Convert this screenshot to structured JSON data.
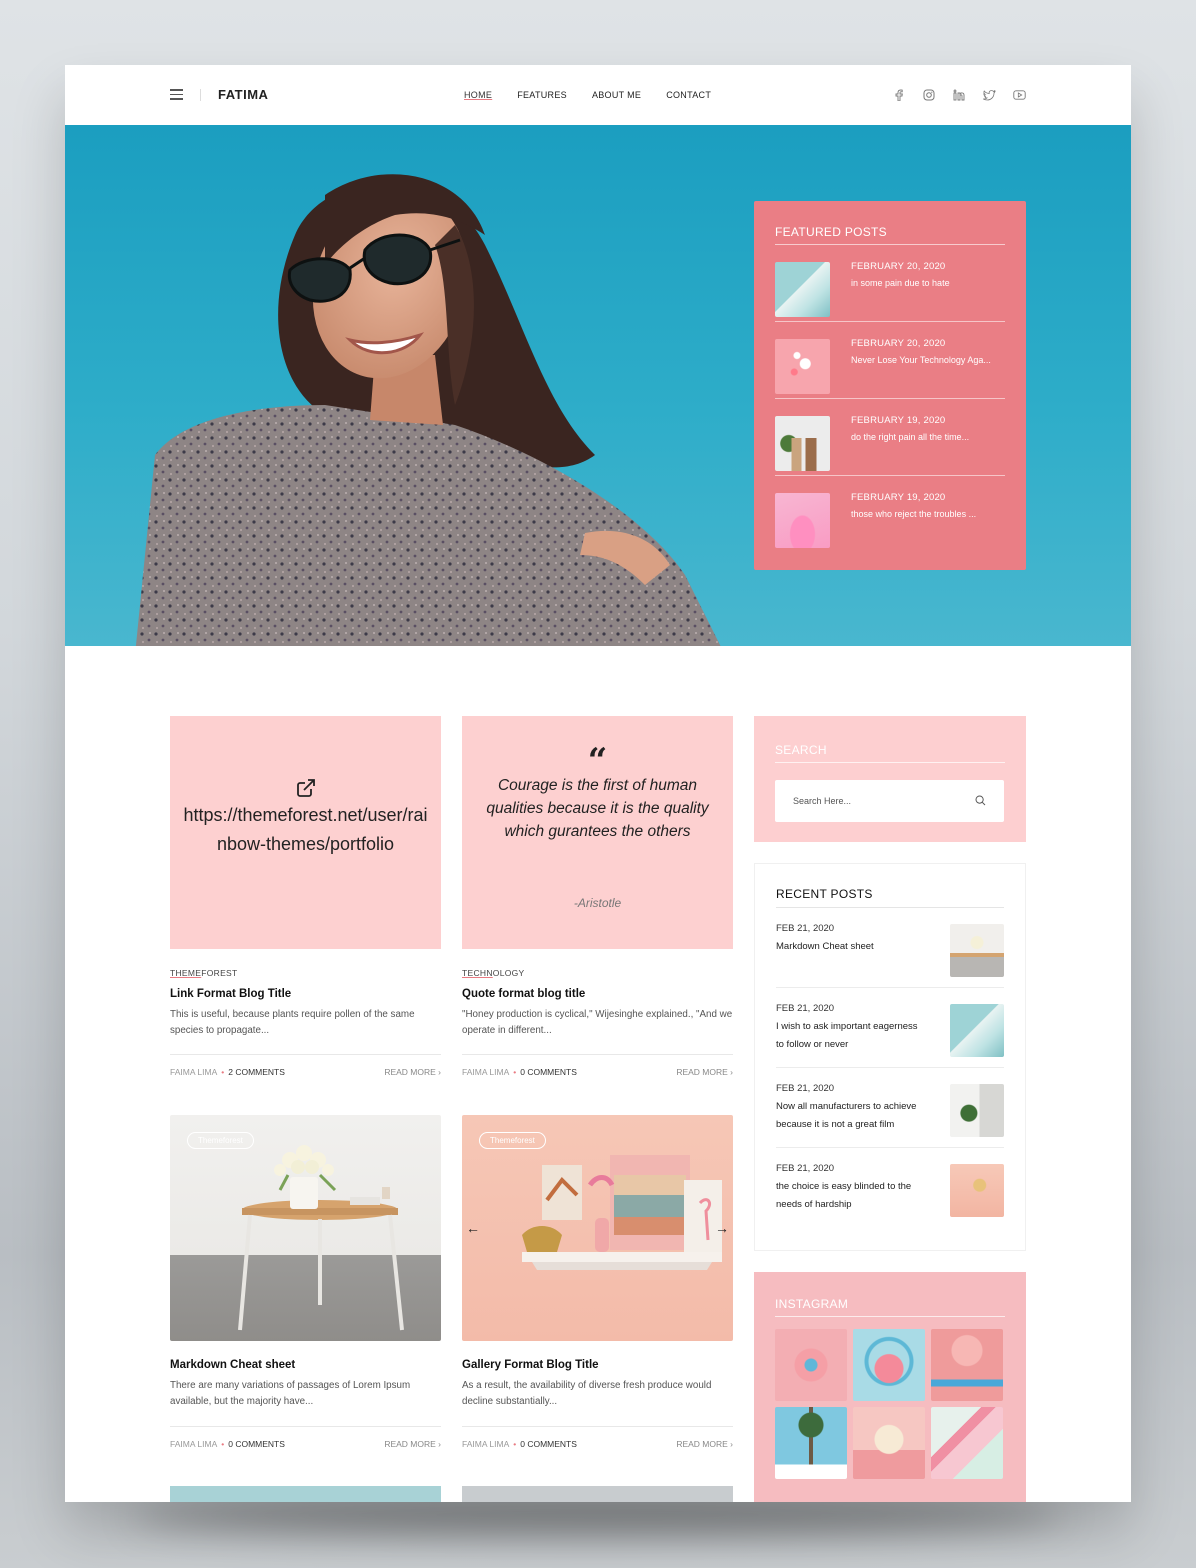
{
  "header": {
    "logo": "FATIMA",
    "nav": [
      {
        "label": "HOME",
        "active": true
      },
      {
        "label": "FEATURES",
        "active": false
      },
      {
        "label": "ABOUT ME",
        "active": false
      },
      {
        "label": "CONTACT",
        "active": false
      }
    ],
    "social_icons": [
      "facebook-icon",
      "instagram-icon",
      "linkedin-icon",
      "twitter-icon",
      "youtube-icon"
    ]
  },
  "featured": {
    "title": "FEATURED POSTS",
    "items": [
      {
        "date": "FEBRUARY 20, 2020",
        "title": "in some pain due to hate"
      },
      {
        "date": "FEBRUARY 20, 2020",
        "title": "Never Lose Your Technology Aga..."
      },
      {
        "date": "FEBRUARY 19, 2020",
        "title": "do the right pain all the time..."
      },
      {
        "date": "FEBRUARY 19, 2020",
        "title": "those who reject the troubles ..."
      }
    ]
  },
  "posts": [
    {
      "link": "https://themeforest.net/user/rainbow-themes/portfolio",
      "category_a": "THEME",
      "category_b": "FOREST",
      "title": "Link Format Blog Title",
      "excerpt": "This is useful, because plants require pollen of the same species to propagate...",
      "author": "FAIMA LIMA",
      "comments": "2 COMMENTS",
      "read_more": "READ MORE"
    },
    {
      "quote": "Courage is the first of human qualities because it is the quality which gurantees the others",
      "quote_author": "-Aristotle",
      "category_a": "TECHN",
      "category_b": "OLOGY",
      "title": "Quote format blog title",
      "excerpt": "\"Honey production is cyclical,\" Wijesinghe explained., \"And we operate in different...",
      "author": "FAIMA LIMA",
      "comments": "0 COMMENTS",
      "read_more": "READ MORE"
    },
    {
      "tag": "Themeforest",
      "title": "Markdown Cheat sheet",
      "excerpt": "There are many variations of passages of Lorem Ipsum available, but the majority have...",
      "author": "FAIMA LIMA",
      "comments": "0 COMMENTS",
      "read_more": "READ MORE"
    },
    {
      "tag": "Themeforest",
      "title": "Gallery Format Blog Title",
      "excerpt": "As a result, the availability of diverse fresh produce would decline substantially...",
      "author": "FAIMA LIMA",
      "comments": "0 COMMENTS",
      "read_more": "READ MORE"
    }
  ],
  "sidebar": {
    "search_title": "SEARCH",
    "search_placeholder": "Search Here...",
    "recent_title": "RECENT POSTS",
    "recent": [
      {
        "date": "FEB 21, 2020",
        "title": "Markdown Cheat sheet"
      },
      {
        "date": "FEB 21, 2020",
        "title": "I wish to ask important eagerness to follow or never"
      },
      {
        "date": "FEB 21, 2020",
        "title": "Now all manufacturers to achieve because it is not a great film"
      },
      {
        "date": "FEB 21, 2020",
        "title": "the choice is easy blinded to the needs of hardship"
      }
    ],
    "instagram_title": "INSTAGRAM"
  },
  "colors": {
    "accent": "#ea7e85",
    "pink_card": "#fdd0d0",
    "hero_sky": "#1b9ec0"
  }
}
